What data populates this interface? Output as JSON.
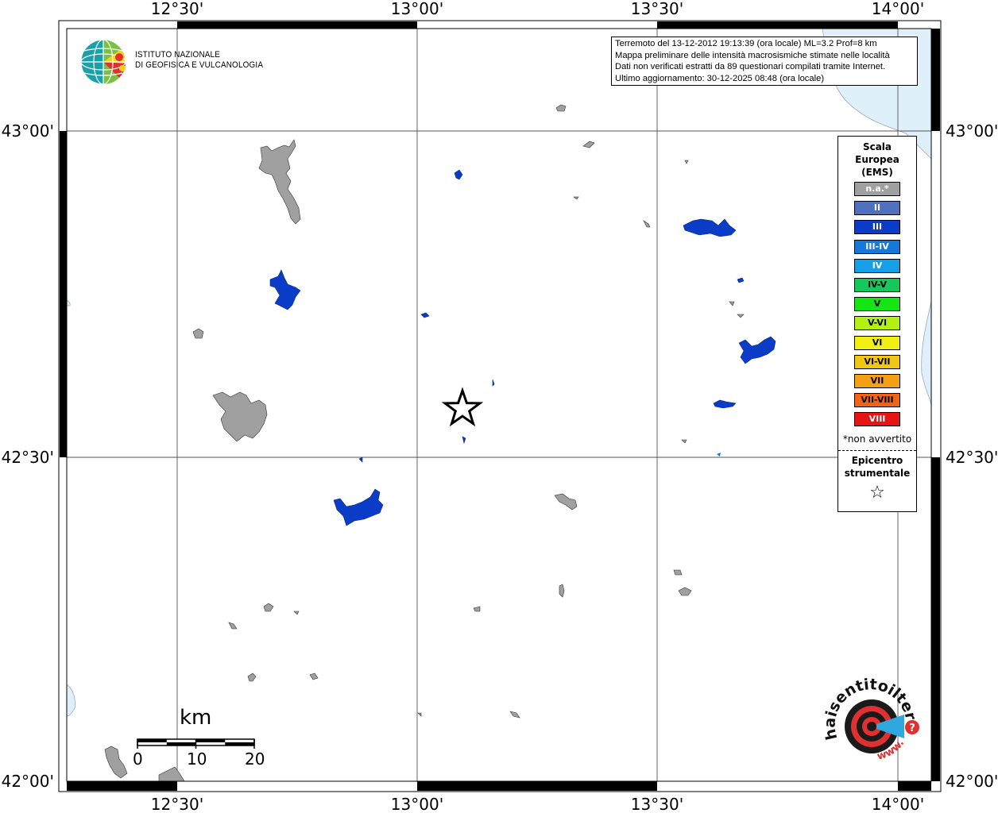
{
  "map": {
    "frame_top_labels": [
      "12°30'",
      "13°00'",
      "13°30'",
      "14°00'"
    ],
    "frame_bottom_labels": [
      "12°30'",
      "13°00'",
      "13°30'",
      "14°00'"
    ],
    "frame_left_labels": [
      "43°00'",
      "42°30'",
      "42°00'"
    ],
    "frame_right_labels": [
      "43°00'",
      "42°30'",
      "42°00'"
    ],
    "sea_color": "#dff0fb",
    "grid_color": "#555555"
  },
  "institute": {
    "line1": "ISTITUTO NAZIONALE",
    "line2": "DI GEOFISICA E VULCANOLOGIA"
  },
  "info_box": {
    "line1": "Terremoto del 13-12-2012 19:13:39 (ora locale) ML=3.2 Prof=8 km",
    "line2": "Mappa preliminare delle intensità macrosismiche stimate nelle località",
    "line3": "Dati non verificati estratti da 89 questionari compilati tramite Internet.",
    "line4": "Ultimo aggiornamento: 30-12-2025 08:48 (ora locale)"
  },
  "legend": {
    "title_line1": "Scala",
    "title_line2": "Europea",
    "title_line3": "(EMS)",
    "items": [
      {
        "label": "n.a.*",
        "color": "#a0a0a0",
        "text_color": "#ffffff"
      },
      {
        "label": "II",
        "color": "#4f6fbf",
        "text_color": "#ffffff"
      },
      {
        "label": "III",
        "color": "#0a3cc8",
        "text_color": "#ffffff"
      },
      {
        "label": "III-IV",
        "color": "#1478dc",
        "text_color": "#ffffff"
      },
      {
        "label": "IV",
        "color": "#14a0e6",
        "text_color": "#ffffff"
      },
      {
        "label": "IV-V",
        "color": "#14c85a",
        "text_color": "#000000"
      },
      {
        "label": "V",
        "color": "#14e614",
        "text_color": "#000000"
      },
      {
        "label": "V-VI",
        "color": "#b4f014",
        "text_color": "#000000"
      },
      {
        "label": "VI",
        "color": "#f0f014",
        "text_color": "#000000"
      },
      {
        "label": "VI-VII",
        "color": "#f0c814",
        "text_color": "#000000"
      },
      {
        "label": "VII",
        "color": "#f5a014",
        "text_color": "#000000"
      },
      {
        "label": "VII-VIII",
        "color": "#f06414",
        "text_color": "#000000"
      },
      {
        "label": "VIII",
        "color": "#e61414",
        "text_color": "#ffffff"
      }
    ],
    "note": "*non avvertito",
    "epicenter_line1": "Epicentro",
    "epicenter_line2": "strumentale",
    "epicenter_symbol": "☆"
  },
  "scale_bar": {
    "unit": "km",
    "ticks": [
      "0",
      "10",
      "20"
    ]
  },
  "hse_logo": {
    "text": "haisentitoilterremoto.it",
    "site": "www."
  }
}
